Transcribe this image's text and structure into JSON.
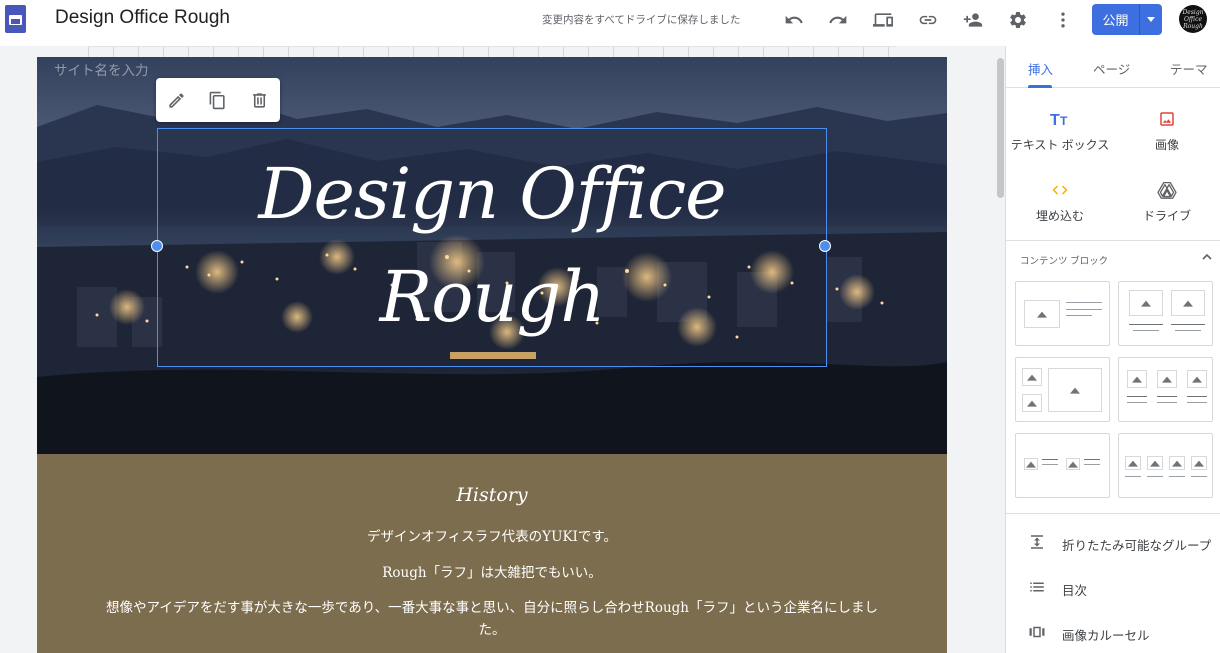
{
  "app": {
    "doc_title": "Design Office Rough",
    "save_status": "変更内容をすべてドライブに保存しました",
    "publish_label": "公開",
    "avatar_text": "Design Office Rough",
    "toolbar_icons": [
      "undo-icon",
      "redo-icon",
      "preview-devices-icon",
      "link-icon",
      "share-person-add-icon",
      "settings-gear-icon",
      "more-vert-icon"
    ]
  },
  "canvas": {
    "site_name_placeholder": "サイト名を入力",
    "hero_toolbar_icons": [
      "edit-pencil-icon",
      "duplicate-icon",
      "delete-trash-icon"
    ],
    "hero_title_line1": "Design Office",
    "hero_title_line2": "Rough",
    "accent_color": "#c9a063",
    "history": {
      "title": "History",
      "line1": "デザインオフィスラフ代表のYUKIです。",
      "line2": "Rough「ラフ」は大雑把でもいい。",
      "line3": "想像やアイデアをだす事が大きな一歩であり、一番大事な事と思い、自分に照らし合わせRough「ラフ」という企業名にしまし",
      "line4": "た。",
      "background_color": "#7d6d4f"
    }
  },
  "panel": {
    "tabs": [
      {
        "label": "挿入",
        "active": true
      },
      {
        "label": "ページ",
        "active": false
      },
      {
        "label": "テーマ",
        "active": false
      }
    ],
    "insert_items": [
      {
        "label": "テキスト ボックス",
        "icon": "text-box-icon",
        "color": "#3d6fe0"
      },
      {
        "label": "画像",
        "icon": "image-icon",
        "color": "#e0453a"
      },
      {
        "label": "埋め込む",
        "icon": "embed-code-icon",
        "color": "#f4b400"
      },
      {
        "label": "ドライブ",
        "icon": "drive-icon",
        "color": "#5f6368"
      }
    ],
    "content_blocks_header": "コンテンツ ブロック",
    "list_items": [
      {
        "label": "折りたたみ可能なグループ",
        "icon": "collapsible-group-icon"
      },
      {
        "label": "目次",
        "icon": "table-of-contents-icon"
      },
      {
        "label": "画像カルーセル",
        "icon": "image-carousel-icon"
      }
    ],
    "accent_color": "#3d6fe0"
  }
}
